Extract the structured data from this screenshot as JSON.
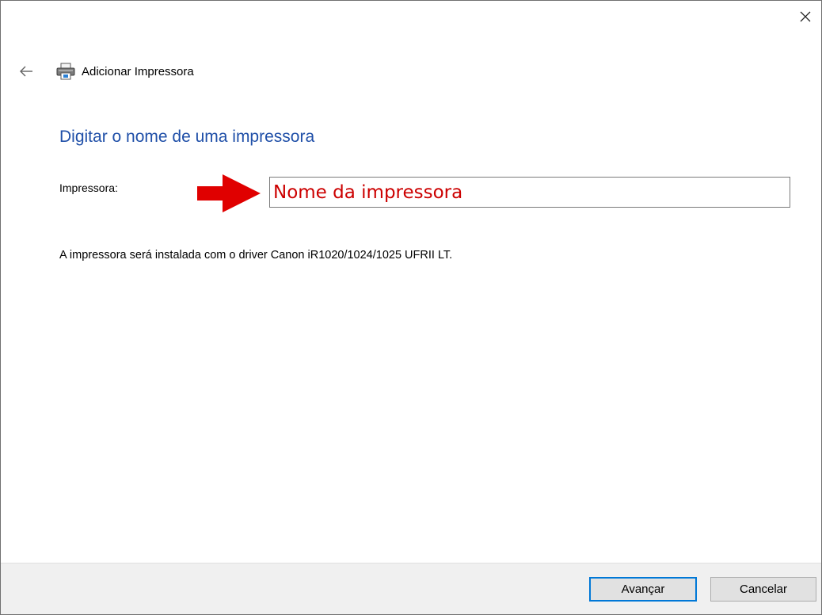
{
  "header": {
    "title": "Adicionar Impressora"
  },
  "main": {
    "heading": "Digitar o nome de uma impressora",
    "printer_label": "Impressora:",
    "printer_value": "Nome da impressora",
    "driver_info": "A impressora será instalada com o driver Canon iR1020/1024/1025 UFRII LT."
  },
  "footer": {
    "next_label": "Avançar",
    "cancel_label": "Cancelar"
  },
  "icons": {
    "close": "close-icon",
    "back": "back-arrow-icon",
    "printer": "printer-icon",
    "annotation": "red-arrow-icon"
  },
  "colors": {
    "heading": "#1f4fa8",
    "annotation": "#cc0000",
    "primary_button_border": "#0078d7",
    "footer_bg": "#f0f0f0"
  }
}
